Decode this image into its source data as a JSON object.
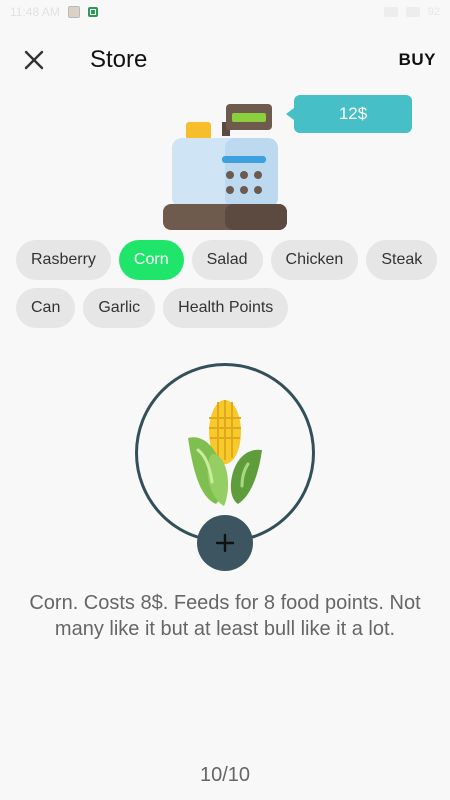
{
  "status": {
    "time": "11:48 AM",
    "battery": "92"
  },
  "appbar": {
    "title": "Store",
    "buy_label": "BUY"
  },
  "price": "12$",
  "chips": [
    {
      "label": "Rasberry",
      "selected": false
    },
    {
      "label": "Corn",
      "selected": true
    },
    {
      "label": "Salad",
      "selected": false
    },
    {
      "label": "Chicken",
      "selected": false
    },
    {
      "label": "Steak",
      "selected": false
    },
    {
      "label": "Can",
      "selected": false
    },
    {
      "label": "Garlic",
      "selected": false
    },
    {
      "label": "Health Points",
      "selected": false
    }
  ],
  "product": {
    "description": "Corn. Costs 8$. Feeds for 8 food points. Not many like it but at least bull like it a lot."
  },
  "pager": "10/10",
  "colors": {
    "accent_green": "#20e56b",
    "bubble": "#46bfc7",
    "dark": "#3c5560"
  }
}
